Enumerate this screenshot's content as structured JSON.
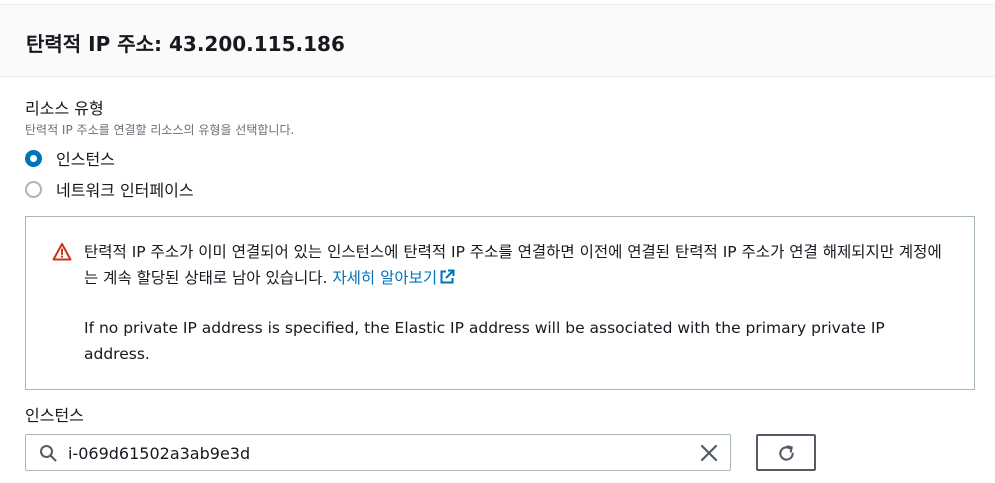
{
  "header": {
    "title": "탄력적 IP 주소: 43.200.115.186"
  },
  "resource_type": {
    "label": "리소스 유형",
    "description": "탄력적 IP 주소를 연결할 리소스의 유형을 선택합니다.",
    "options": [
      {
        "label": "인스턴스",
        "checked": true
      },
      {
        "label": "네트워크 인터페이스",
        "checked": false
      }
    ]
  },
  "alert": {
    "icon": "warning-icon",
    "message": "탄력적 IP 주소가 이미 연결되어 있는 인스턴스에 탄력적 IP 주소를 연결하면 이전에 연결된 탄력적 IP 주소가 연결 해제되지만 계정에는 계속 할당된 상태로 남아 있습니다.",
    "link_label": "자세히 알아보기",
    "note": "If no private IP address is specified, the Elastic IP address will be associated with the primary private IP address."
  },
  "instance": {
    "label": "인스턴스",
    "value": "i-069d61502a3ab9e3d"
  },
  "colors": {
    "accent": "#0073bb",
    "warning": "#d13212",
    "border": "#aab7b8",
    "text": "#16191f"
  }
}
